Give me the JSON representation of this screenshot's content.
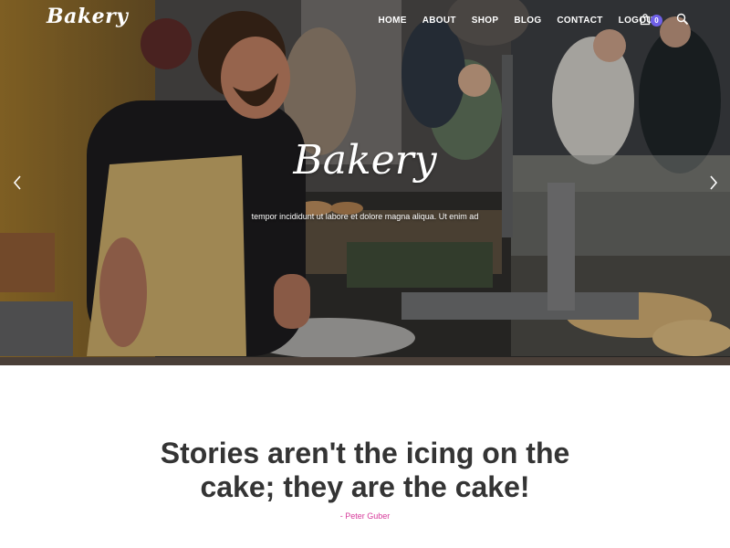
{
  "header": {
    "logo": "Bakery",
    "nav": [
      "HOME",
      "ABOUT",
      "SHOP",
      "BLOG",
      "CONTACT",
      "LOGOUT"
    ],
    "cart_count": "0",
    "cart_icon": "shopping-bag-icon",
    "search_icon": "search-icon"
  },
  "hero": {
    "title": "Bakery",
    "subtitle": "tempor incididunt ut labore et dolore magna aliqua. Ut enim ad",
    "prev_icon": "chevron-left-icon",
    "next_icon": "chevron-right-icon"
  },
  "quote": {
    "text": "Stories aren't the icing on the cake; they are the cake!",
    "author": "- Peter Guber"
  },
  "colors": {
    "accent_purple": "#6f60e8",
    "accent_pink": "#d6399a",
    "heading": "#343434"
  }
}
